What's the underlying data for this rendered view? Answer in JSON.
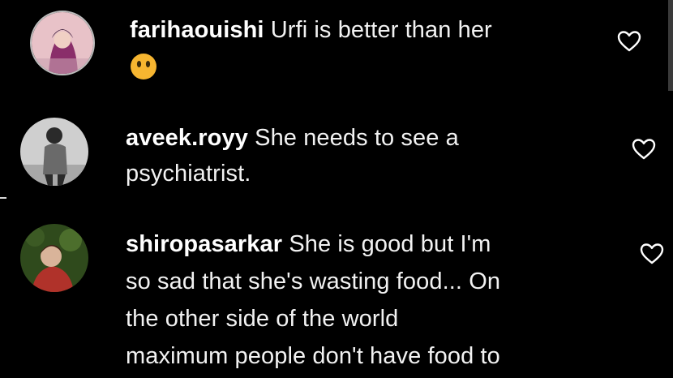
{
  "comments": [
    {
      "username": "farihaouishi",
      "text": "Urfi is better than her",
      "emoji": "😶",
      "emoji_icon": "face-without-mouth-emoji",
      "avatar_colors": [
        "#e8c2c8",
        "#8a2e6a",
        "#3b1c3a"
      ]
    },
    {
      "username": "aveek.royy",
      "text_line1": "She needs to see a",
      "text_line2": "psychiatrist.",
      "avatar_colors": [
        "#cfcfcf",
        "#6a6a6a",
        "#2a2a2a"
      ]
    },
    {
      "username": "shiropasarkar",
      "text_line1": "She is good but I'm",
      "text_line2": "so sad that she's wasting food... On",
      "text_line3": "the other side of the world",
      "text_line4": "maximum people don't have food to",
      "avatar_colors": [
        "#2f4a1c",
        "#b0322a",
        "#d9b49a"
      ]
    }
  ],
  "like_icon": "heart-outline-icon",
  "colors": {
    "background": "#000000",
    "text": "#f2f2f2",
    "username": "#ffffff",
    "icon": "#ffffff",
    "emoji": "#f6b530"
  }
}
